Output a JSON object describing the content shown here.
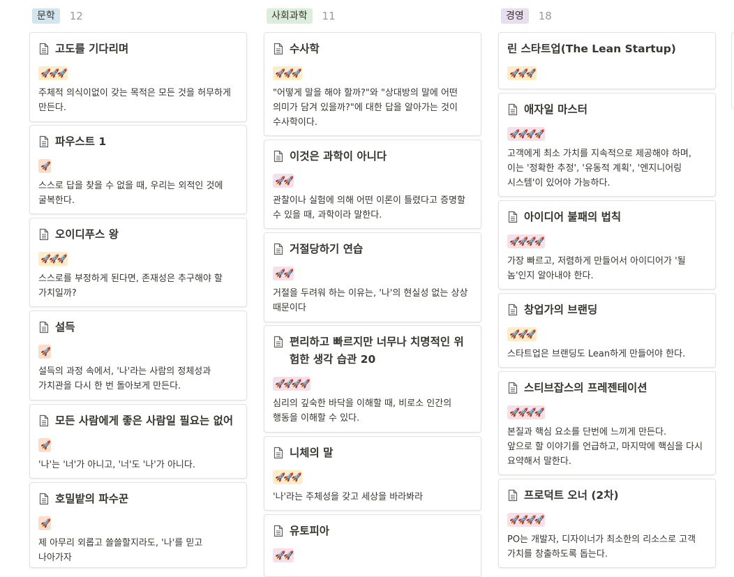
{
  "colors": {
    "lit_tag": "#d3e5ef",
    "soc_tag": "#dbeddb",
    "biz_tag": "#e8deee"
  },
  "columns": [
    {
      "name": "문학",
      "count": "12",
      "tag_color": "#d3e5ef",
      "cards": [
        {
          "title": "고도를 기다리며",
          "icon": true,
          "rating": "🚀🚀🚀",
          "rclass": "r3",
          "desc": "주체적 의식이없이 갖는 목적은 모든 것을 허무하게 만든다."
        },
        {
          "title": "파우스트 1",
          "icon": true,
          "rating": "🚀",
          "rclass": "r1",
          "desc": "스스로 답을 찾을 수 없을 때, 우리는 외적인 것에 굴복한다."
        },
        {
          "title": "오이디푸스 왕",
          "icon": true,
          "rating": "🚀🚀🚀",
          "rclass": "r3",
          "desc": "스스로를 부정하게 된다면, 존재성은 추구해야 할 가치일까?"
        },
        {
          "title": "설득",
          "icon": true,
          "rating": "🚀",
          "rclass": "r1",
          "desc": "설득의 과정 속에서, '나'라는 사람의 정체성과 가치관을 다시 한 번 돌아보게 만든다."
        },
        {
          "title": "모든 사람에게 좋은 사람일 필요는 없어",
          "icon": true,
          "rating": "🚀",
          "rclass": "r1",
          "desc": "'나'는 '너'가 아니고, '너'도 '나'가 아니다."
        },
        {
          "title": "호밀밭의 파수꾼",
          "icon": true,
          "rating": "🚀",
          "rclass": "r1",
          "desc": "제 아무리 외롭고 쓸쓸할지라도, '나'를 믿고 나아가자"
        }
      ]
    },
    {
      "name": "사회과학",
      "count": "11",
      "tag_color": "#dbeddb",
      "cards": [
        {
          "title": "수사학",
          "icon": true,
          "rating": "🚀🚀🚀",
          "rclass": "r3",
          "desc": "\"어떻게 말을 해야 할까?\"와 \"상대방의 말에 어떤 의미가 담겨 있을까?\"에 대한 답을 알아가는 것이 수사학이다."
        },
        {
          "title": "이것은 과학이 아니다",
          "icon": true,
          "rating": "🚀🚀",
          "rclass": "r2",
          "desc": "관찰이나 실험에 의해 어떤 이론이 틀렸다고 증명할 수 있을 때, 과학이라 말한다."
        },
        {
          "title": "거절당하기 연습",
          "icon": true,
          "rating": "🚀🚀",
          "rclass": "r2",
          "desc": "거절을 두려워 하는 이유는, '나'의 현실성 없는 상상 때문이다"
        },
        {
          "title": "편리하고 빠르지만 너무나 치명적인 위험한 생각 습관 20",
          "icon": true,
          "rating": "🚀🚀🚀🚀",
          "rclass": "r4",
          "desc": "심리의 깊숙한 바닥을 이해할 때, 비로소 인간의 행동을 이해할 수 있다."
        },
        {
          "title": "니체의 말",
          "icon": true,
          "rating": "🚀🚀🚀",
          "rclass": "r3",
          "desc": "'나'라는 주체성을 갖고 세상을 바라봐라"
        },
        {
          "title": "유토피아",
          "icon": true,
          "rating": "🚀🚀",
          "rclass": "r2",
          "desc": ""
        }
      ]
    },
    {
      "name": "경영",
      "count": "18",
      "tag_color": "#e8deee",
      "cards": [
        {
          "title": "린 스타트업(The Lean Startup)",
          "icon": false,
          "rating": "🚀🚀🚀",
          "rclass": "r3",
          "desc": ""
        },
        {
          "title": "애자일 마스터",
          "icon": true,
          "rating": "🚀🚀🚀🚀",
          "rclass": "r4",
          "desc": "고객에게 최소 가치를 지속적으로 제공해야 하며, 이는 '정확한 추정', '유동적 계획', '엔지니어링 시스템'이 있어야 가능하다."
        },
        {
          "title": "아이디어 불패의 법칙",
          "icon": true,
          "rating": "🚀🚀🚀🚀",
          "rclass": "r4",
          "desc": "가장 빠르고, 저렴하게 만들어서 아이디어가 '될 놈'인지 알아내야 한다."
        },
        {
          "title": "창업가의 브랜딩",
          "icon": true,
          "rating": "🚀🚀🚀",
          "rclass": "r3",
          "desc": "스타트업은 브랜딩도 Lean하게 만들어야 한다."
        },
        {
          "title": "스티브잡스의 프레젠테이션",
          "icon": true,
          "rating": "🚀🚀🚀🚀",
          "rclass": "r4",
          "desc": "본질과 핵심 요소를 단번에 느끼게 만든다.\n앞으로 할 이야기를 언급하고, 마지막에 핵심을 다시 요약해서 말한다."
        },
        {
          "title": "프로덕트 오너 (2차)",
          "icon": true,
          "rating": "🚀🚀🚀🚀",
          "rclass": "r4",
          "desc": "PO는 개발자, 디자이너가 최소한의 리소스로 고객 가치를 창출하도록 돕는다."
        }
      ]
    }
  ]
}
